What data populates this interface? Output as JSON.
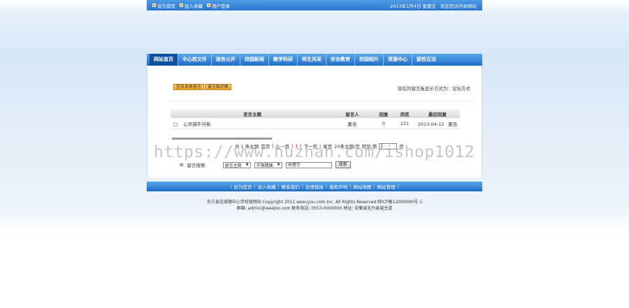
{
  "topbar": {
    "links": [
      "设为首页",
      "加入收藏",
      "用户登录"
    ],
    "date": "2013年1月4日 星期五",
    "welcome": "欢迎您访问本网站"
  },
  "nav": {
    "items": [
      "网站首页",
      "中心校文件",
      "政务公开",
      "校园新闻",
      "教学科研",
      "师生风采",
      "安全教育",
      "校园相片",
      "资源中心",
      "家校互动"
    ]
  },
  "content": {
    "btn_post": "签名发表留言",
    "btn_switch": "留言板切换",
    "mode_text": "现在的留言板显示方式为：论坛方式",
    "table": {
      "headers": [
        "发言主题",
        "留言人",
        "回复",
        "浏览",
        "最后回复"
      ],
      "rows": [
        {
          "icon": "□",
          "topic": "心灵捕手问卷",
          "author": "匿名",
          "replies": "0",
          "views": "151",
          "last_date": "2013-04-12",
          "last_user": "匿名"
        }
      ]
    },
    "pager": {
      "total": "共 1 条主题",
      "first": "首页",
      "prev": "上一页",
      "current": "1",
      "next": "下一页",
      "last": "尾页",
      "per_page": "20条主题/页",
      "goto": "转到:第",
      "page_input": "1",
      "page_suffix": "页"
    },
    "search": {
      "label": "留言搜索:",
      "select1": "留言主题",
      "select2": "不限精确",
      "input_value": "关键字",
      "button": "搜索"
    }
  },
  "footer": {
    "links": [
      "设为首页",
      "加入收藏",
      "联系我们",
      "友情链接",
      "版权声明",
      "网站地图",
      "网站管理"
    ],
    "copyright": "东方县志城镇中心学校营网站 Copyright 2011 weecyou.com Inc. All Rights Reserved 皖ICP备12000000号-1",
    "contact": "邮箱: admin@weejoo.com  联系电话: 0553-0000000  地址: 安徽省无为县城主道"
  },
  "watermark": "https://www.huzhan.com/ishop1012",
  "colors": {
    "nav_blue": "#1f6cc7",
    "button_orange": "#f5a623",
    "pager_current": "#dd0000"
  }
}
